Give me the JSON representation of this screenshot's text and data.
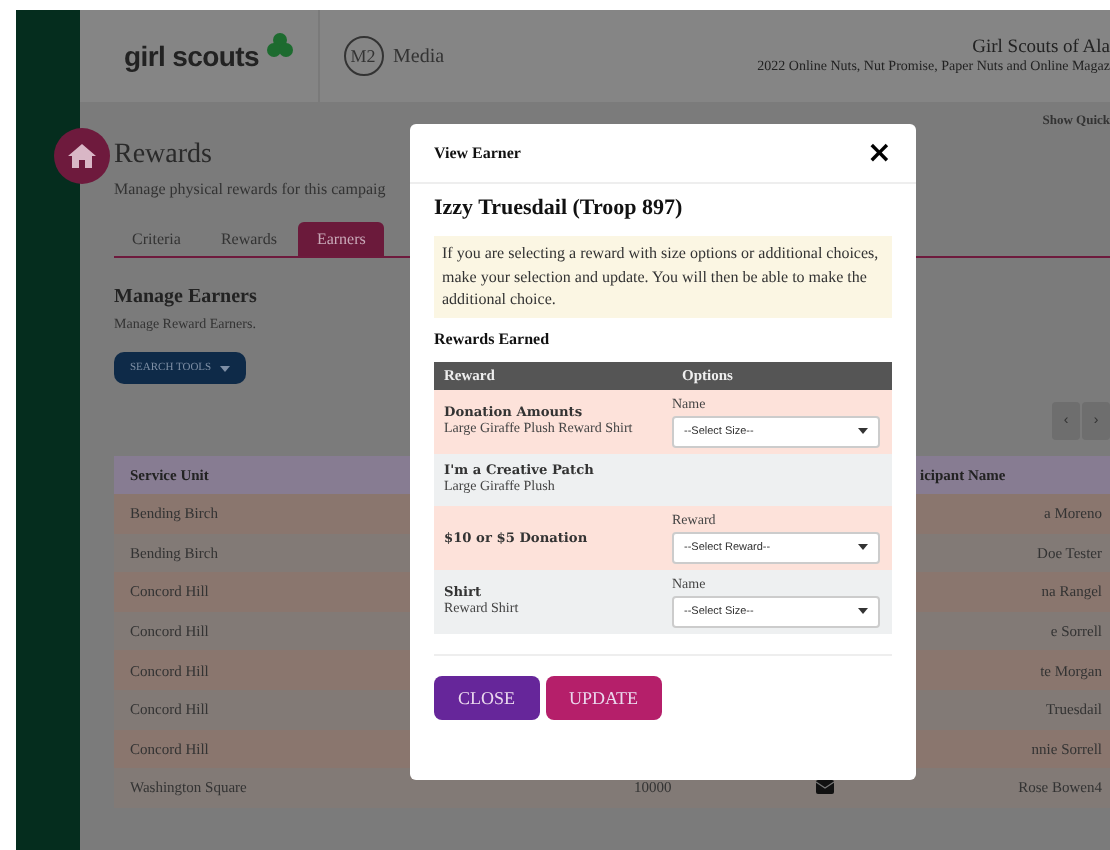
{
  "header": {
    "logo": "girl scouts",
    "media_badge": "M2",
    "media_label": "Media",
    "org": "Girl Scouts of Ala",
    "campaign": "2022 Online Nuts, Nut Promise, Paper Nuts and Online Magaz"
  },
  "quick_link": "Show Quick",
  "page": {
    "title": "Rewards",
    "subtitle": "Manage physical rewards for this campaig"
  },
  "tabs": [
    {
      "label": "Criteria",
      "selected": false
    },
    {
      "label": "Rewards",
      "selected": false
    },
    {
      "label": "Earners",
      "selected": true
    }
  ],
  "section": {
    "title": "Manage Earners",
    "subtitle": "Manage Reward Earners.",
    "search_button": "SEARCH TOOLS",
    "pager": [
      "‹",
      "›"
    ]
  },
  "table": {
    "columns": [
      "Service Unit",
      "icipant Name"
    ],
    "rows": [
      {
        "unit": "Bending Birch",
        "participant": "a Moreno"
      },
      {
        "unit": "Bending Birch",
        "participant": "Doe Tester"
      },
      {
        "unit": "Concord Hill",
        "participant": "na Rangel"
      },
      {
        "unit": "Concord Hill",
        "participant": "e Sorrell"
      },
      {
        "unit": "Concord Hill",
        "participant": "te Morgan"
      },
      {
        "unit": "Concord Hill",
        "participant": "Truesdail"
      },
      {
        "unit": "Concord Hill",
        "participant": "nnie Sorrell"
      },
      {
        "unit": "Washington Square",
        "troop": "10000",
        "message": true,
        "participant": "Rose Bowen4"
      }
    ]
  },
  "modal": {
    "title": "View Earner",
    "close_glyph": "×",
    "earner": "Izzy Truesdail (Troop 897)",
    "notice": "If you are selecting a reward with size options or additional choices, make your selection and update. You will then be able to make the additional choice.",
    "rewards_title": "Rewards Earned",
    "columns": [
      "Reward",
      "Options"
    ],
    "rewards": [
      {
        "name": "Donation Amounts",
        "detail": "Large Giraffe Plush Reward Shirt",
        "highlight": true,
        "option_label": "Name",
        "select": "--Select Size--"
      },
      {
        "name": "I'm a Creative Patch",
        "detail": "Large Giraffe Plush",
        "highlight": false
      },
      {
        "name": "$10 or $5 Donation",
        "highlight": true,
        "option_label": "Reward",
        "select": "--Select Reward--"
      },
      {
        "name": "Shirt",
        "detail": "Reward Shirt",
        "highlight": false,
        "option_label": "Name",
        "select": "--Select Size--"
      }
    ],
    "buttons": [
      {
        "label": "CLOSE",
        "kind": "close"
      },
      {
        "label": "UPDATE",
        "kind": "update"
      }
    ]
  }
}
